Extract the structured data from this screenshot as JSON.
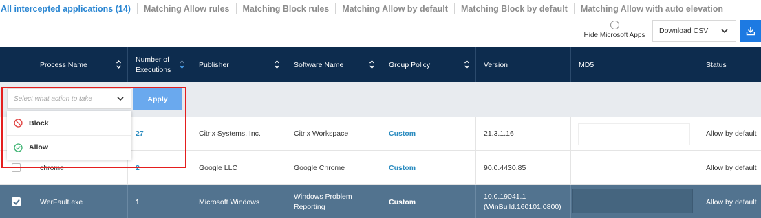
{
  "tabs": [
    {
      "label": "All intercepted applications (14)",
      "active": true
    },
    {
      "label": "Matching Allow rules",
      "active": false
    },
    {
      "label": "Matching Block rules",
      "active": false
    },
    {
      "label": "Matching Allow by default",
      "active": false
    },
    {
      "label": "Matching Block by default",
      "active": false
    },
    {
      "label": "Matching Allow with auto elevation",
      "active": false
    }
  ],
  "toolbar": {
    "hide_ms_label": "Hide Microsoft Apps",
    "download_select_value": "Download CSV",
    "download_icon": "download-icon"
  },
  "columns": {
    "process_name": "Process Name",
    "executions_line1": "Number of",
    "executions_line2": "Executions",
    "publisher": "Publisher",
    "software_name": "Software Name",
    "group_policy": "Group Policy",
    "version": "Version",
    "md5": "MD5",
    "status": "Status"
  },
  "action": {
    "placeholder": "Select what action to take",
    "apply_label": "Apply",
    "options": [
      {
        "label": "Block",
        "icon": "block-icon"
      },
      {
        "label": "Allow",
        "icon": "allow-icon"
      }
    ]
  },
  "rows": [
    {
      "process": "",
      "executions": "27",
      "publisher": "Citrix Systems, Inc.",
      "software": "Citrix Workspace",
      "policy": "Custom",
      "version": "21.3.1.16",
      "version2": "",
      "status": "Allow by default",
      "checked": false
    },
    {
      "process": "chrome",
      "executions": "2",
      "publisher": "Google LLC",
      "software": "Google Chrome",
      "policy": "Custom",
      "version": "90.0.4430.85",
      "version2": "",
      "status": "Allow by default",
      "checked": false
    },
    {
      "process": "WerFault.exe",
      "executions": "1",
      "publisher": "Microsoft Windows",
      "software": "Windows Problem",
      "software2": "Reporting",
      "policy": "Custom",
      "version": "10.0.19041.1",
      "version2": "(WinBuild.160101.0800)",
      "status": "Allow by default",
      "checked": true
    }
  ],
  "colors": {
    "header_bg": "#0d2c4e",
    "accent": "#2a86d2",
    "apply_bg": "#6aa9ee",
    "selected_row": "#52738f",
    "highlight": "#e41e1e"
  }
}
